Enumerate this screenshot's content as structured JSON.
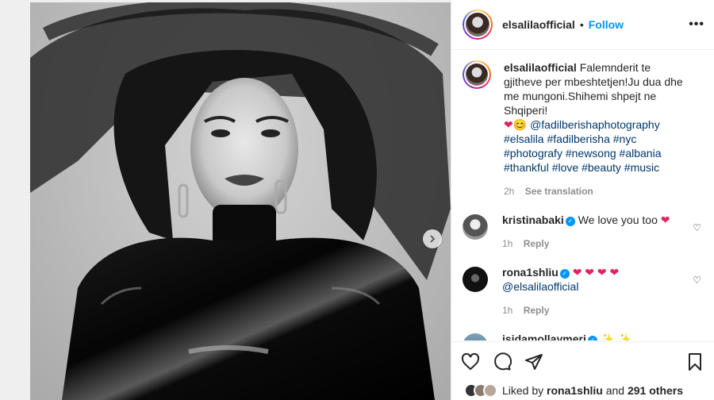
{
  "post": {
    "username": "elsalilaofficial",
    "follow_label": "Follow",
    "dot": "•",
    "more_label": "•••"
  },
  "caption": {
    "username": "elsalilaofficial",
    "text_1": "Falemnderit te gjitheve per mbeshtetjen!Ju dua dhe me mungoni.Shihemi shpejt ne Shqiperi!",
    "emoji": "❤",
    "emoji_2": "😊",
    "mention": "@fadilberishaphotography",
    "hashtags": "#elsalila #fadilberisha #nyc #photografy #newsong #albania #thankful #love #beauty #music",
    "time": "2h",
    "see_translation": "See translation"
  },
  "comments": [
    {
      "username": "kristinabaki",
      "text": "We love you too",
      "emoji": "❤",
      "time": "1h",
      "reply": "Reply"
    },
    {
      "username": "rona1shliu",
      "emoji": "❤ ❤ ❤ ❤",
      "mention": "@elsalilaofficial",
      "time": "1h",
      "reply": "Reply"
    },
    {
      "username": "isidamollaymeri",
      "emoji": "✨ ✨"
    }
  ],
  "likes": {
    "prefix": "Liked by",
    "user": "rona1shliu",
    "and": "and",
    "others": "291 others"
  },
  "icons": {
    "like": "heart-icon",
    "comment": "comment-icon",
    "share": "share-icon",
    "save": "bookmark-icon",
    "next": "chevron-right-icon"
  },
  "colors": {
    "accent": "#0095f6",
    "heart": "#e0245e",
    "text": "#262626",
    "muted": "#8e8e8e"
  }
}
